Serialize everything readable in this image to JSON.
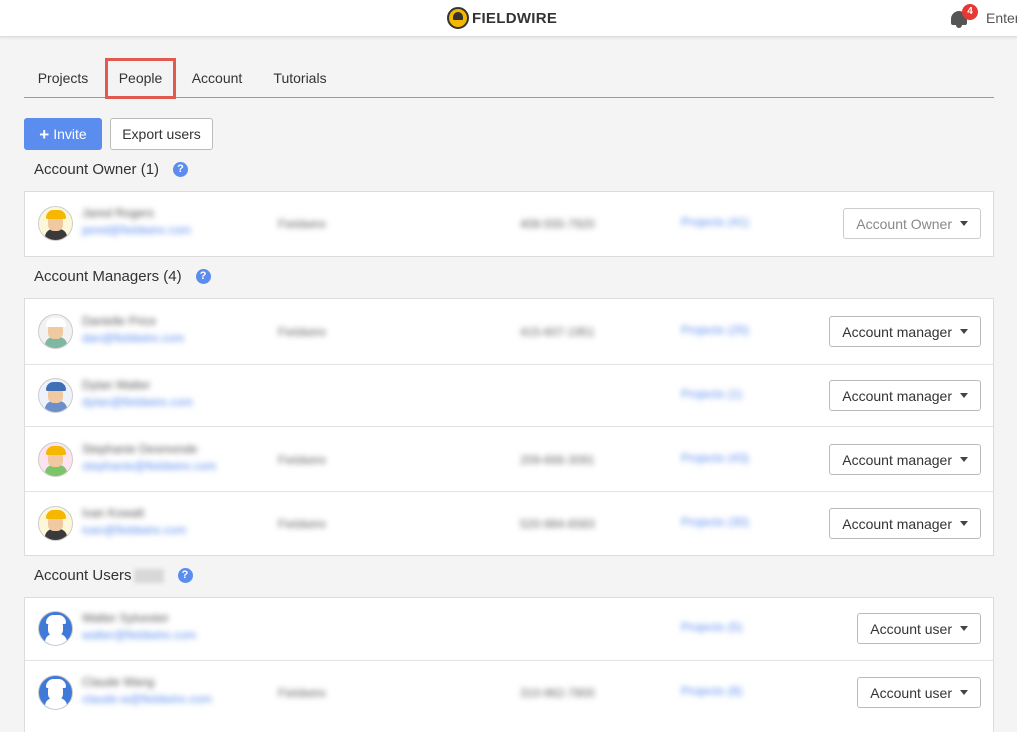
{
  "header": {
    "logo_text": "FIELDWIRE",
    "notification_count": "4",
    "right_link": "Enter"
  },
  "tabs": [
    {
      "label": "Projects"
    },
    {
      "label": "People",
      "active": true
    },
    {
      "label": "Account"
    },
    {
      "label": "Tutorials"
    }
  ],
  "toolbar": {
    "invite_label": "Invite",
    "export_label": "Export users"
  },
  "sections": {
    "owner": {
      "title": "Account Owner (1)",
      "rows": [
        {
          "name": "Jared Rogers",
          "email": "jared@fieldwire.com",
          "org": "Fieldwire",
          "phone": "408-555-7920",
          "projects": "Projects (41)",
          "role": "Account Owner",
          "avatar": "yellow-hat",
          "role_muted": true
        }
      ]
    },
    "managers": {
      "title": "Account Managers (4)",
      "rows": [
        {
          "name": "Danielle Price",
          "email": "dan@fieldwire.com",
          "org": "Fieldwire",
          "phone": "415-607-1951",
          "projects": "Projects (25)",
          "role": "Account manager",
          "avatar": "white-hat"
        },
        {
          "name": "Dylan Walter",
          "email": "dylan@fieldwire.com",
          "org": "",
          "phone": "",
          "projects": "Projects (1)",
          "role": "Account manager",
          "avatar": "blue-hat"
        },
        {
          "name": "Stephanie Desmonde",
          "email": "stephanie@fieldwire.com",
          "org": "Fieldwire",
          "phone": "209-666-3091",
          "projects": "Projects (43)",
          "role": "Account manager",
          "avatar": "pink-hat"
        },
        {
          "name": "Ivan Kowalt",
          "email": "ivan@fieldwire.com",
          "org": "Fieldwire",
          "phone": "520-984-6583",
          "projects": "Projects (30)",
          "role": "Account manager",
          "avatar": "yellow-hat"
        }
      ]
    },
    "users": {
      "title": "Account Users",
      "rows": [
        {
          "name": "Walter Sylvester",
          "email": "walter@fieldwire.com",
          "org": "",
          "phone": "",
          "projects": "Projects (5)",
          "role": "Account user",
          "avatar": "default"
        },
        {
          "name": "Claude Wang",
          "email": "claude.w@fieldwire.com",
          "org": "Fieldwire",
          "phone": "310-962-7800",
          "projects": "Projects (8)",
          "role": "Account user",
          "avatar": "default"
        }
      ]
    }
  }
}
